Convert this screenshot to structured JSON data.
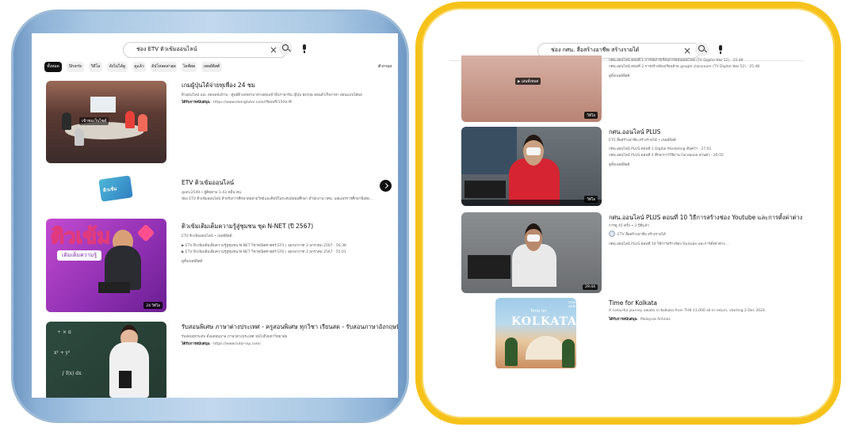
{
  "left": {
    "search": {
      "query": "ช่อง ETV ติวเข้มออนไลน์"
    },
    "chips": [
      "ทั้งหมด",
      "Shorts",
      "วิดีโอ",
      "ยังไม่ได้ดู",
      "ดูแล้ว",
      "อัปโหลดล่าสุด",
      "ไลฟ์สด",
      "เพลย์ลิสต์"
    ],
    "chips_right": "ตัวกรอง",
    "results": [
      {
        "title": "เกมผู้ปุ่นได้จ่ายทุเพื่อง 24 ชม",
        "meta1": "ติวออนไลน์ และ สอนหนังบ้าน - ศูนย์ติวเลขสามาทางสอบเข้าทั้งภาษาจีน ญี่ปุ่น อังกฤษ สอนสำเร็จภาษา สอนแบบได้ผล",
        "sponsor": "ได้รับการสนับสนุน",
        "url": "https://www.kleingtutor.com/เรียนฟรี/150นาที",
        "overlay": "เข้าชมเว็บไซต์"
      },
      {
        "title": "ETV ติวเข้มออนไลน์",
        "meta1": "@etv2549 • ผู้ติดตาม 1.43 หมื่น คน",
        "meta2": "ช่อง ETV ติวเข้มออนไลน์ สำหรับการศึกษาต่อสายวิทย์และศิลป์ในระดับมัธยมศึกษา สำนักงาน กศน. เผยแพร่การศึกษาพิเศษ...",
        "logo_text": "ติวเข้ม"
      },
      {
        "title": "ติวเข้มเติมเต็มความรู้สู่ชุมชน ชุด N-NET (ปี 2567)",
        "channel": "ETV ติวเข้มออนไลน์ • เพลย์ลิสต์",
        "line1": "▶ ETV ติวเข้มเติมเต็มความรู้สู่ชุมชน N-NET วิชาคณิตศาสตร์ EP1 | ออกอากาศ 3 มกราคม 2567 · 56:38",
        "line2": "▶ ETV ติวเข้มเติมเต็มความรู้สู่ชุมชน N-NET วิชาคณิตศาสตร์ EP2 | ออกอากาศ 3 มกราคม 2567 · 55:01",
        "more": "ดูทั้งเพลย์ลิสต์",
        "badge": "24 วิดีโอ",
        "thumb_big": "ติวเข้ม",
        "thumb_sub": "เติมเต็มความรู้"
      },
      {
        "title": "รับสอนพิเศษ ภาษาต่างประเทศ - ครูสอนพิเศษ ทุกวิชา เรียนสด - รับสอนภาษาอังกฤษที่บ้าน",
        "meta1": "รับสอนทุกระดับ ตั้งแต่อนุบาล ภาษาต่างประเทศ จนไปถึงมหาวิทยาลัย",
        "sponsor": "ได้รับการสนับสนุน",
        "url": "https://www.tutor-vip.com/"
      }
    ]
  },
  "right": {
    "search": {
      "query": "ช่อง กศน. สื่อสร้างอาชีพ สร้างรายได้"
    },
    "results": [
      {
        "line1": "กศน.ออนไลน์ ตอนที่ 1 การจัดการเรียนการสอนออนไลน์ (TV Digital ช่อง 52) · 25:48",
        "line2": "กศน.ออนไลน์ ตอนที่ 2 การสร้างห้องเรียนด้วย google classroom (TV Digital ช่อง 52) · 25:48",
        "more": "ดูทั้งเพลย์ลิสต์",
        "overlay": "▶ เล่นทั้งหมด",
        "badge": "วิดีโอ"
      },
      {
        "title": "กศน.ออนไลน์ PLUS",
        "channel": "ETV สื่อสร้างอาชีพ สร้างรายได้ • เพลย์ลิสต์",
        "line1": "กศน.ออนไลน์ PLUS ตอนที่ 1 Digital Marketing ค้นคว้า · 27:01",
        "line2": "กศน.ออนไลน์ PLUS ตอนที่ 2 ศึกษาการใช้งาน Facebook ส่วนตัว · 26:55",
        "more": "ดูทั้งเพลย์ลิสต์",
        "badge": "วิดีโอ"
      },
      {
        "title": "กศน.ออนไลน์ PLUS ตอนที่ 10 วิธีการสร้างช่อง Youtube และการตั้งค่าต่าง ๆ",
        "meta1": "การดู 45 ครั้ง • 2 ปีที่แล้ว",
        "channel": "ETV สื่อสร้างอาชีพ สร้างรายได้",
        "meta2": "กศน.ออนไลน์ PLUS ตอนที่ 10 วิธีการสร้างช่อง Youtube และการตั้งค่าต่าง...",
        "badge": "29:44"
      },
      {
        "title": "Time for Kolkata",
        "meta1": "A colourful journey awaits in Kolkata from THB 13,000 all-in return, starting 2 Dec 2024.",
        "sponsor": "ได้รับการสนับสนุน",
        "advertiser": "Malaysia Airlines",
        "thumb_text": "KOLKATA",
        "thumb_small": "Time for",
        "thumb_logo": "malaysia airlines"
      }
    ]
  }
}
